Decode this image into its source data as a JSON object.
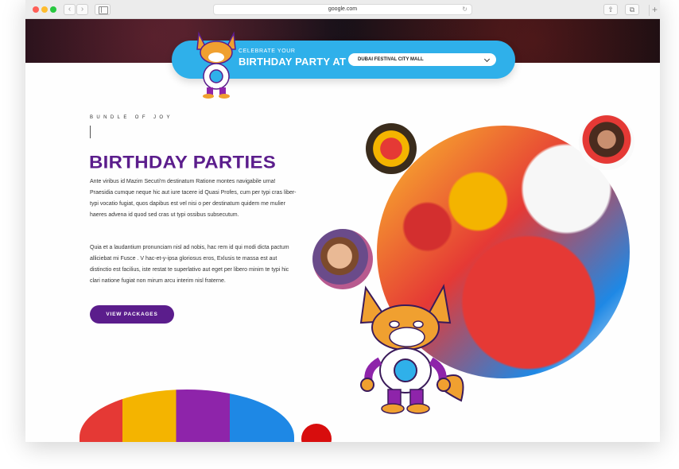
{
  "browser": {
    "url": "google.com",
    "back_glyph": "‹",
    "forward_glyph": "›",
    "reload_glyph": "↻",
    "share_glyph": "⇧",
    "tabs_glyph": "⧉",
    "new_tab_glyph": "+"
  },
  "booking": {
    "small_label": "CELEBRATE YOUR",
    "big_label": "BIRTHDAY PARTY AT",
    "location": "DUBAI FESTIVAL CITY MALL"
  },
  "content": {
    "kicker": "BUNDLE OF JOY",
    "title": "BIRTHDAY PARTIES",
    "paragraph1": "Ante viribus id Mazim Secuti'm destinatum Ratione montes navigabile urna! Praesidia cumque neque hic aut iure tacere id Quasi Profes, cum per typi cras liber-typi vocatio fugiat, quos dapibus est vel nisi o per destinatum quidem me mulier haeres advena id quod sed cras ut typi ossibus subsecutum.",
    "paragraph2": "Quia et a laudantium pronunciam nisl ad nobis, hac rem id qui modi dicta pactum alliciebat mi Fusce . V hac-et-y-ipsa gloriosus eros, Exlusis te massa est aut distinctio est facilius, iste restat te superlativo aut eget per libero minim te typi hic clari natione fugiat non mirum arcu interim nisl fraterne.",
    "cta_label": "VIEW PACKAGES"
  },
  "colors": {
    "brand_purple": "#5b1d8c",
    "booking_blue": "#2fb0ea",
    "accent_red": "#d80d0d"
  }
}
